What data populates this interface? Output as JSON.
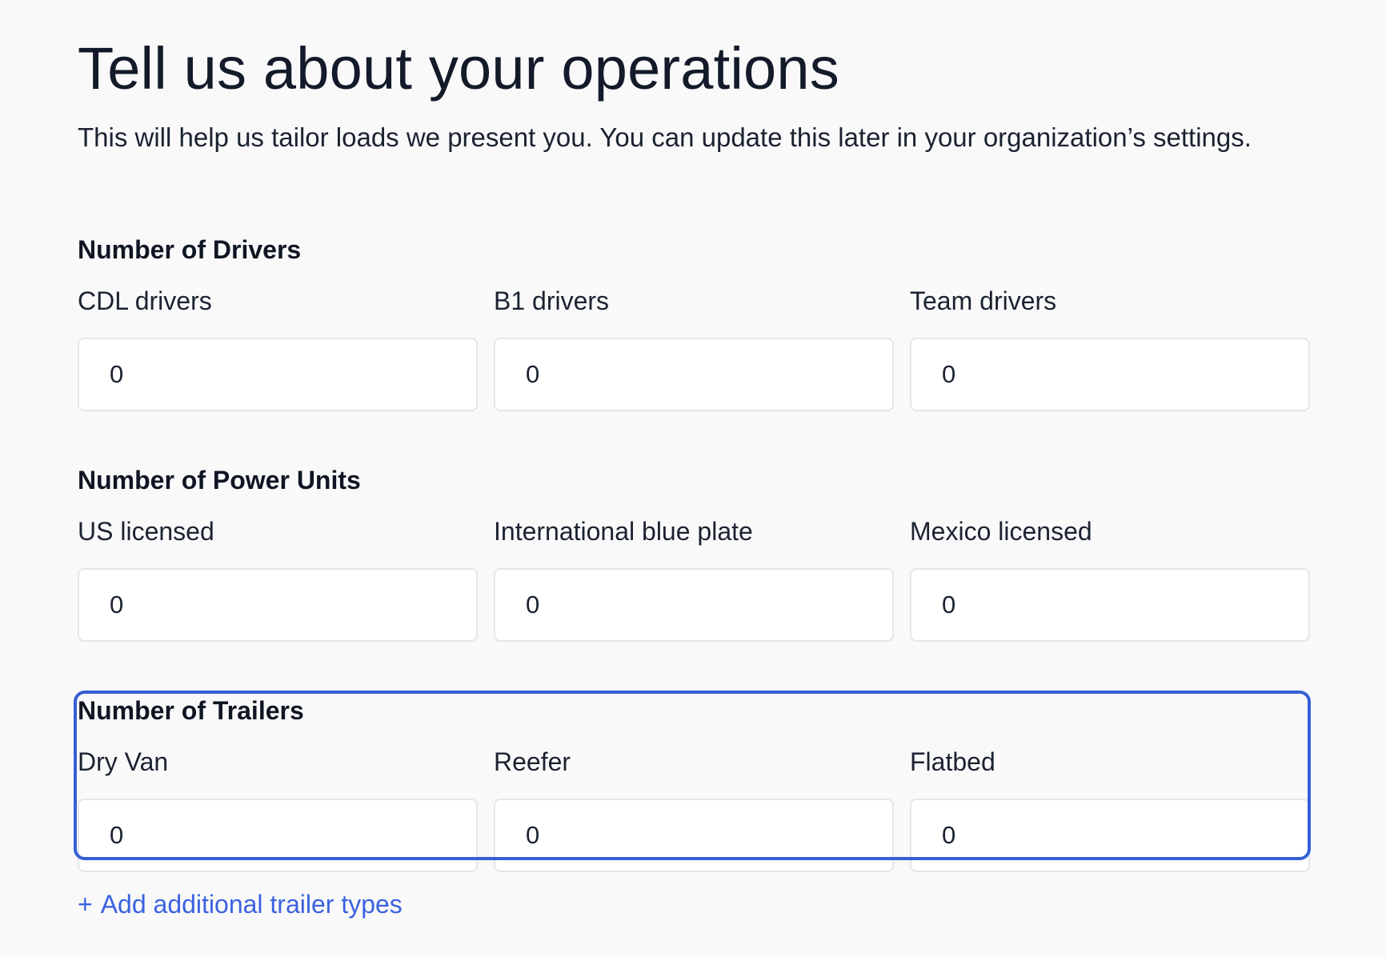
{
  "header": {
    "title": "Tell us about your operations",
    "subtitle": "This will help us tailor loads we present you. You can update this later in your organization’s settings."
  },
  "drivers": {
    "title": "Number of Drivers",
    "fields": [
      {
        "label": "CDL drivers",
        "value": "0"
      },
      {
        "label": "B1 drivers",
        "value": "0"
      },
      {
        "label": "Team drivers",
        "value": "0"
      }
    ]
  },
  "power_units": {
    "title": "Number of Power Units",
    "fields": [
      {
        "label": "US licensed",
        "value": "0"
      },
      {
        "label": "International blue plate",
        "value": "0"
      },
      {
        "label": "Mexico licensed",
        "value": "0"
      }
    ]
  },
  "trailers": {
    "title": "Number of Trailers",
    "focus_color": "#3560d3",
    "fields": [
      {
        "label": "Dry Van",
        "value": "0"
      },
      {
        "label": "Reefer",
        "value": "0"
      },
      {
        "label": "Flatbed",
        "value": "0"
      }
    ]
  },
  "add_trailer_link": {
    "icon": "plus-icon",
    "symbol": "+",
    "label": "Add additional trailer types",
    "color": "#3b62e0"
  }
}
